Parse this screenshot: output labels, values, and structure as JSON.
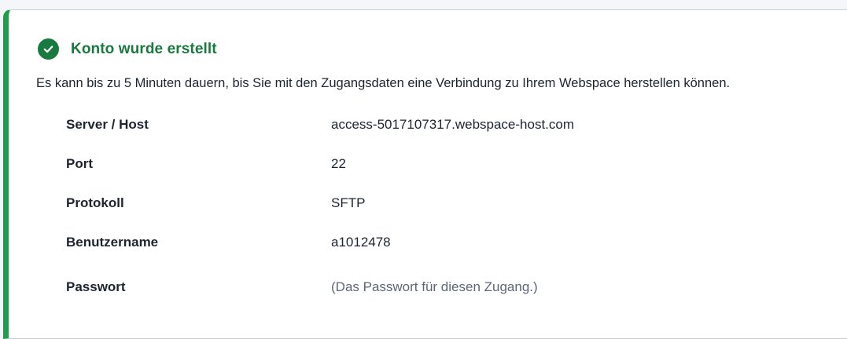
{
  "notice": {
    "icon": "check-circle-icon",
    "accent_color": "#1f9d4c",
    "title": "Konto wurde erstellt",
    "description": "Es kann bis zu 5 Minuten dauern, bis Sie mit den Zugangsdaten eine Verbindung zu Ihrem Webspace herstellen können."
  },
  "details": [
    {
      "label": "Server / Host",
      "value": "access-5017107317.webspace-host.com"
    },
    {
      "label": "Port",
      "value": "22"
    },
    {
      "label": "Protokoll",
      "value": "SFTP"
    },
    {
      "label": "Benutzername",
      "value": "a1012478"
    },
    {
      "label": "Passwort",
      "value": "(Das Passwort für diesen Zugang.)"
    }
  ]
}
